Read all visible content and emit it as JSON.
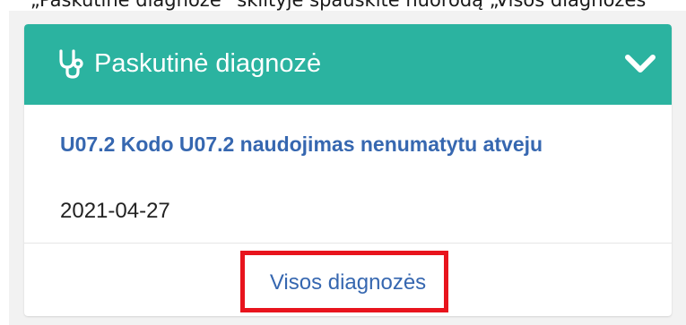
{
  "instruction": {
    "text": "„Paskutinė diagnozė“ skiltyje spauskite nuorodą „Visos diagnozės“"
  },
  "panel": {
    "title": "Paskutinė diagnozė",
    "title_icon": "stethoscope-icon",
    "toggle_icon": "chevron-down-icon",
    "header_color": "#2bb3a0"
  },
  "diagnosis": {
    "code_and_name": "U07.2 Kodo U07.2 naudojimas nenumatytu atveju",
    "date": "2021-04-27",
    "link_color": "#3667b0"
  },
  "footer": {
    "all_diagnoses_label": "Visos diagnozės"
  },
  "highlight": {
    "color": "#e8141d"
  }
}
